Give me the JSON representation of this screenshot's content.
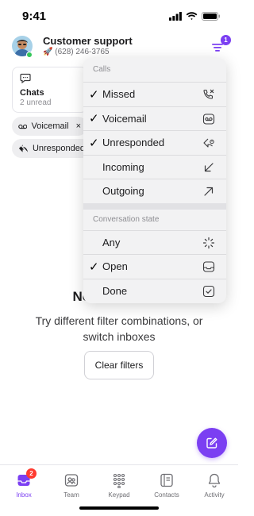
{
  "status_bar": {
    "time": "9:41",
    "icons": [
      "signal-icon",
      "wifi-icon",
      "battery-icon"
    ]
  },
  "header": {
    "title": "Customer support",
    "emoji": "🚀",
    "phone": "(628) 246-3765",
    "filter_badge": "1",
    "icons": [
      "avatar",
      "filter-icon"
    ]
  },
  "chats_card": {
    "label": "Chats",
    "subtitle": "2 unread",
    "icon": "chat-bubble-icon"
  },
  "chips": [
    {
      "label": "Voicemail",
      "icon": "voicemail-icon",
      "close": "×"
    },
    {
      "label": "Unresponded",
      "icon": "unresponded-icon"
    }
  ],
  "empty_state": {
    "title": "No calls found",
    "description": "Try different filter combinations, or switch inboxes"
  },
  "clear_button": "Clear filters",
  "dropdown": {
    "calls_header": "Calls",
    "calls_items": [
      {
        "label": "Missed",
        "checked": true,
        "check_glyph": "✓",
        "icon": "missed-call-icon"
      },
      {
        "label": "Voicemail",
        "checked": true,
        "check_glyph": "✓",
        "icon": "voicemail-icon"
      },
      {
        "label": "Unresponded",
        "checked": true,
        "check_glyph": "✓",
        "icon": "unresponded-icon"
      },
      {
        "label": "Incoming",
        "checked": false,
        "check_glyph": "",
        "icon": "incoming-arrow-icon"
      },
      {
        "label": "Outgoing",
        "checked": false,
        "check_glyph": "",
        "icon": "outgoing-arrow-icon"
      }
    ],
    "state_header": "Conversation state",
    "state_items": [
      {
        "label": "Any",
        "checked": false,
        "check_glyph": "",
        "icon": "spinner-icon"
      },
      {
        "label": "Open",
        "checked": true,
        "check_glyph": "✓",
        "icon": "inbox-tray-icon"
      },
      {
        "label": "Done",
        "checked": false,
        "check_glyph": "",
        "icon": "checkbox-icon"
      }
    ]
  },
  "fab": {
    "icon": "compose-icon"
  },
  "tabbar": {
    "tabs": [
      {
        "label": "Inbox",
        "active": true,
        "badge": "2",
        "icon": "inbox-icon"
      },
      {
        "label": "Team",
        "active": false,
        "icon": "team-icon"
      },
      {
        "label": "Keypad",
        "active": false,
        "icon": "keypad-icon"
      },
      {
        "label": "Contacts",
        "active": false,
        "icon": "contacts-icon"
      },
      {
        "label": "Activity",
        "active": false,
        "icon": "bell-icon"
      }
    ]
  },
  "colors": {
    "accent": "#7b3ff2",
    "badge_red": "#ff3b30",
    "online_green": "#34c759",
    "menu_bg": "#f2f2f3"
  }
}
